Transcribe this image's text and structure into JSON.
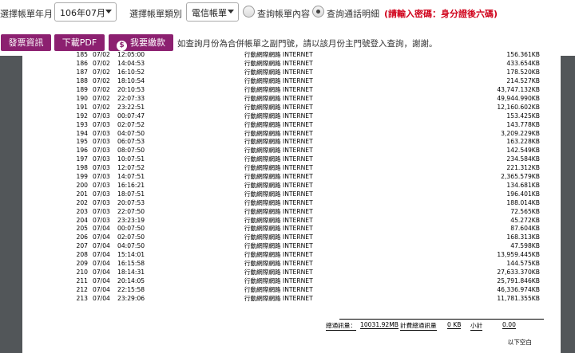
{
  "top": {
    "month_label": "選擇帳單年月",
    "month_value": "106年07月",
    "type_label": "選擇帳單類別",
    "type_value": "電信帳單",
    "radio_content": "查詢帳單內容",
    "radio_detail": "查詢通話明細",
    "password_note": "(請輸入密碼：身分證後六碼)"
  },
  "actions": {
    "invoice_button": "發票資訊",
    "pdf_button": "下載PDF",
    "pay_icon": "$",
    "pay_button": "我要繳款",
    "info": "如查詢月份為合併帳單之副門號，請以該月份主門號登入查詢，謝謝。"
  },
  "statement": {
    "partial_row": {
      "no": "185",
      "date": "07/02",
      "time": "12:05:00",
      "service": "行動網際網路 INTERNET",
      "amount": "156.361KB"
    },
    "rows": [
      {
        "no": "186",
        "date": "07/02",
        "time": "14:04:53",
        "service": "行動網際網路 INTERNET",
        "amount": "433.654KB"
      },
      {
        "no": "187",
        "date": "07/02",
        "time": "16:10:52",
        "service": "行動網際網路 INTERNET",
        "amount": "178.520KB"
      },
      {
        "no": "188",
        "date": "07/02",
        "time": "18:10:54",
        "service": "行動網際網路 INTERNET",
        "amount": "214.527KB"
      },
      {
        "no": "189",
        "date": "07/02",
        "time": "20:10:53",
        "service": "行動網際網路 INTERNET",
        "amount": "43,747.132KB"
      },
      {
        "no": "190",
        "date": "07/02",
        "time": "22:07:33",
        "service": "行動網際網路 INTERNET",
        "amount": "49,944.990KB"
      },
      {
        "no": "191",
        "date": "07/02",
        "time": "23:22:51",
        "service": "行動網際網路 INTERNET",
        "amount": "12,160.602KB"
      },
      {
        "no": "192",
        "date": "07/03",
        "time": "00:07:47",
        "service": "行動網際網路 INTERNET",
        "amount": "153.425KB"
      },
      {
        "no": "193",
        "date": "07/03",
        "time": "02:07:52",
        "service": "行動網際網路 INTERNET",
        "amount": "143.778KB"
      },
      {
        "no": "194",
        "date": "07/03",
        "time": "04:07:50",
        "service": "行動網際網路 INTERNET",
        "amount": "3,209.229KB"
      },
      {
        "no": "195",
        "date": "07/03",
        "time": "06:07:53",
        "service": "行動網際網路 INTERNET",
        "amount": "163.228KB"
      },
      {
        "no": "196",
        "date": "07/03",
        "time": "08:07:50",
        "service": "行動網際網路 INTERNET",
        "amount": "142.549KB"
      },
      {
        "no": "197",
        "date": "07/03",
        "time": "10:07:51",
        "service": "行動網際網路 INTERNET",
        "amount": "234.584KB"
      },
      {
        "no": "198",
        "date": "07/03",
        "time": "12:07:52",
        "service": "行動網際網路 INTERNET",
        "amount": "221.312KB"
      },
      {
        "no": "199",
        "date": "07/03",
        "time": "14:07:51",
        "service": "行動網際網路 INTERNET",
        "amount": "2,365.579KB"
      },
      {
        "no": "200",
        "date": "07/03",
        "time": "16:16:21",
        "service": "行動網際網路 INTERNET",
        "amount": "134.681KB"
      },
      {
        "no": "201",
        "date": "07/03",
        "time": "18:07:51",
        "service": "行動網際網路 INTERNET",
        "amount": "196.401KB"
      },
      {
        "no": "202",
        "date": "07/03",
        "time": "20:07:53",
        "service": "行動網際網路 INTERNET",
        "amount": "188.014KB"
      },
      {
        "no": "203",
        "date": "07/03",
        "time": "22:07:50",
        "service": "行動網際網路 INTERNET",
        "amount": "72.565KB"
      },
      {
        "no": "204",
        "date": "07/03",
        "time": "23:23:19",
        "service": "行動網際網路 INTERNET",
        "amount": "45.272KB"
      },
      {
        "no": "205",
        "date": "07/04",
        "time": "00:07:50",
        "service": "行動網際網路 INTERNET",
        "amount": "87.604KB"
      },
      {
        "no": "206",
        "date": "07/04",
        "time": "02:07:50",
        "service": "行動網際網路 INTERNET",
        "amount": "168.313KB"
      },
      {
        "no": "207",
        "date": "07/04",
        "time": "04:07:50",
        "service": "行動網際網路 INTERNET",
        "amount": "47.598KB"
      },
      {
        "no": "208",
        "date": "07/04",
        "time": "15:14:01",
        "service": "行動網際網路 INTERNET",
        "amount": "13,959.445KB"
      },
      {
        "no": "209",
        "date": "07/04",
        "time": "16:15:58",
        "service": "行動網際網路 INTERNET",
        "amount": "144.575KB"
      },
      {
        "no": "210",
        "date": "07/04",
        "time": "18:14:31",
        "service": "行動網際網路 INTERNET",
        "amount": "27,633.370KB"
      },
      {
        "no": "211",
        "date": "07/04",
        "time": "20:14:05",
        "service": "行動網際網路 INTERNET",
        "amount": "25,791.846KB"
      },
      {
        "no": "212",
        "date": "07/04",
        "time": "22:15:58",
        "service": "行動網際網路 INTERNET",
        "amount": "46,336.974KB"
      },
      {
        "no": "213",
        "date": "07/04",
        "time": "23:29:06",
        "service": "行動網際網路 INTERNET",
        "amount": "11,781.355KB"
      }
    ],
    "summary": {
      "total_label": "總通訊量：",
      "total_value": "10031.92MB",
      "billed_label": "計費總通訊量",
      "billed_value": "0 KB",
      "subtotal_label": "小計",
      "subtotal_value": "0.00"
    },
    "footer": "以下空白"
  },
  "colors": {
    "brand": "#8c2070",
    "note_red": "#d0021b",
    "viewer_bg": "#525659"
  }
}
